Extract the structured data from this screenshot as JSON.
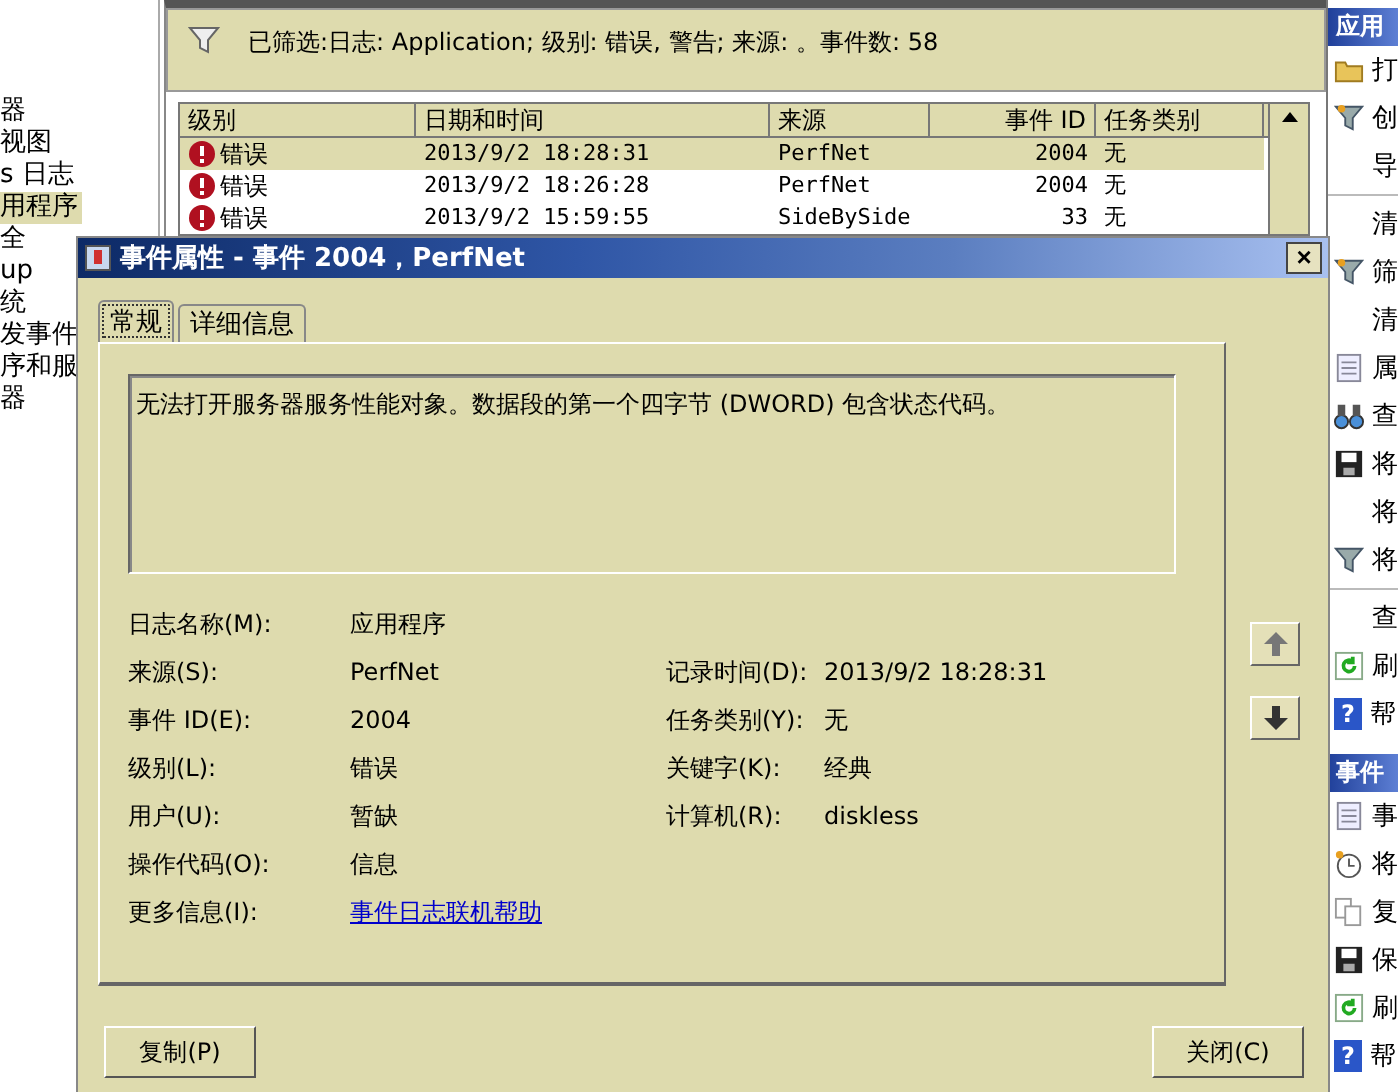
{
  "tree": {
    "items": [
      {
        "label": "器",
        "selected": false
      },
      {
        "label": "视图",
        "selected": false
      },
      {
        "label": "s 日志",
        "selected": false
      },
      {
        "label": "用程序",
        "selected": true
      },
      {
        "label": "全",
        "selected": false
      },
      {
        "label": "up",
        "selected": false
      },
      {
        "label": "统",
        "selected": false
      },
      {
        "label": "发事件",
        "selected": false
      },
      {
        "label": "序和服",
        "selected": false
      },
      {
        "label": "器",
        "selected": false
      }
    ]
  },
  "filter_bar": {
    "text": "已筛选:日志: Application; 级别: 错误, 警告; 来源: 。事件数: 58"
  },
  "table": {
    "columns": [
      "级别",
      "日期和时间",
      "来源",
      "事件 ID",
      "任务类别"
    ],
    "rows": [
      {
        "level": "错误",
        "datetime": "2013/9/2 18:28:31",
        "source": "PerfNet",
        "event_id": "2004",
        "task": "无",
        "selected": true
      },
      {
        "level": "错误",
        "datetime": "2013/9/2 18:26:28",
        "source": "PerfNet",
        "event_id": "2004",
        "task": "无",
        "selected": false
      },
      {
        "level": "错误",
        "datetime": "2013/9/2 15:59:55",
        "source": "SideBySide",
        "event_id": "33",
        "task": "无",
        "selected": false
      }
    ]
  },
  "actions_pane": {
    "sections": [
      {
        "title": "应用",
        "items": [
          {
            "kind": "folder",
            "label": "打"
          },
          {
            "kind": "filter",
            "label": "创"
          },
          {
            "kind": "plain",
            "label": "导"
          },
          {
            "kind": "divider"
          },
          {
            "kind": "plain",
            "label": "清"
          },
          {
            "kind": "filter",
            "label": "筛"
          },
          {
            "kind": "plain",
            "label": "清"
          },
          {
            "kind": "document",
            "label": "属"
          },
          {
            "kind": "find",
            "label": "查"
          },
          {
            "kind": "save",
            "label": "将"
          },
          {
            "kind": "plain",
            "label": "将"
          },
          {
            "kind": "filtersave",
            "label": "将"
          },
          {
            "kind": "divider"
          },
          {
            "kind": "plain",
            "label": "查"
          },
          {
            "kind": "refresh",
            "label": "刷"
          },
          {
            "kind": "help",
            "label": "帮",
            "mark": "?"
          }
        ]
      },
      {
        "title": "事件",
        "items": [
          {
            "kind": "document",
            "label": "事"
          },
          {
            "kind": "clock",
            "label": "将"
          },
          {
            "kind": "copy",
            "label": "复"
          },
          {
            "kind": "save",
            "label": "保"
          },
          {
            "kind": "refresh",
            "label": "刷"
          },
          {
            "kind": "help",
            "label": "帮",
            "mark": "?"
          }
        ]
      }
    ]
  },
  "dialog": {
    "title": "事件属性 - 事件 2004，PerfNet",
    "close_button": "×",
    "tabs": [
      {
        "label": "常规",
        "selected": true
      },
      {
        "label": "详细信息",
        "selected": false
      }
    ],
    "description": "无法打开服务器服务性能对象。数据段的第一个四字节 (DWORD) 包含状态代码。",
    "fields": [
      {
        "label": "日志名称(M):",
        "value": "应用程序"
      },
      {
        "label": "来源(S):",
        "value": "PerfNet",
        "label_2": "记录时间(D):",
        "value_2": "2013/9/2 18:28:31"
      },
      {
        "label": "事件 ID(E):",
        "value": "2004",
        "label_2": "任务类别(Y):",
        "value_2": "无"
      },
      {
        "label": "级别(L):",
        "value": "错误",
        "label_2": "关键字(K):",
        "value_2": "经典"
      },
      {
        "label": "用户(U):",
        "value": "暂缺",
        "label_2": "计算机(R):",
        "value_2": "diskless"
      },
      {
        "label": "操作代码(O):",
        "value": "信息"
      }
    ],
    "more_info": {
      "label": "更多信息(I):",
      "link": "事件日志联机帮助"
    },
    "buttons": [
      "复制(P)",
      "关闭(C)"
    ]
  }
}
